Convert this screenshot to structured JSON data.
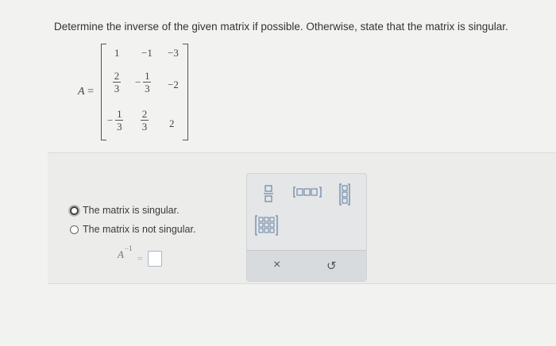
{
  "question": "Determine the inverse of the given matrix if possible. Otherwise, state that the matrix is singular.",
  "matrix": {
    "name": "A",
    "equals": "=",
    "rows": [
      [
        "1",
        "−1",
        "−3"
      ],
      [
        {
          "num": "2",
          "den": "3"
        },
        {
          "sign": "−",
          "num": "1",
          "den": "3"
        },
        "−2"
      ],
      [
        {
          "sign": "−",
          "num": "1",
          "den": "3"
        },
        {
          "num": "2",
          "den": "3"
        },
        "2"
      ]
    ]
  },
  "options": [
    {
      "label": "The matrix is singular.",
      "selected": true
    },
    {
      "label": "The matrix is not singular.",
      "selected": false
    }
  ],
  "answer": {
    "base": "A",
    "exponent": "−1",
    "equals": "="
  },
  "toolbox": {
    "tools": [
      "fraction-tool",
      "row-vector-tool",
      "column-vector-tool",
      "matrix-tool"
    ],
    "clear_label": "×",
    "undo_label": "↺"
  }
}
